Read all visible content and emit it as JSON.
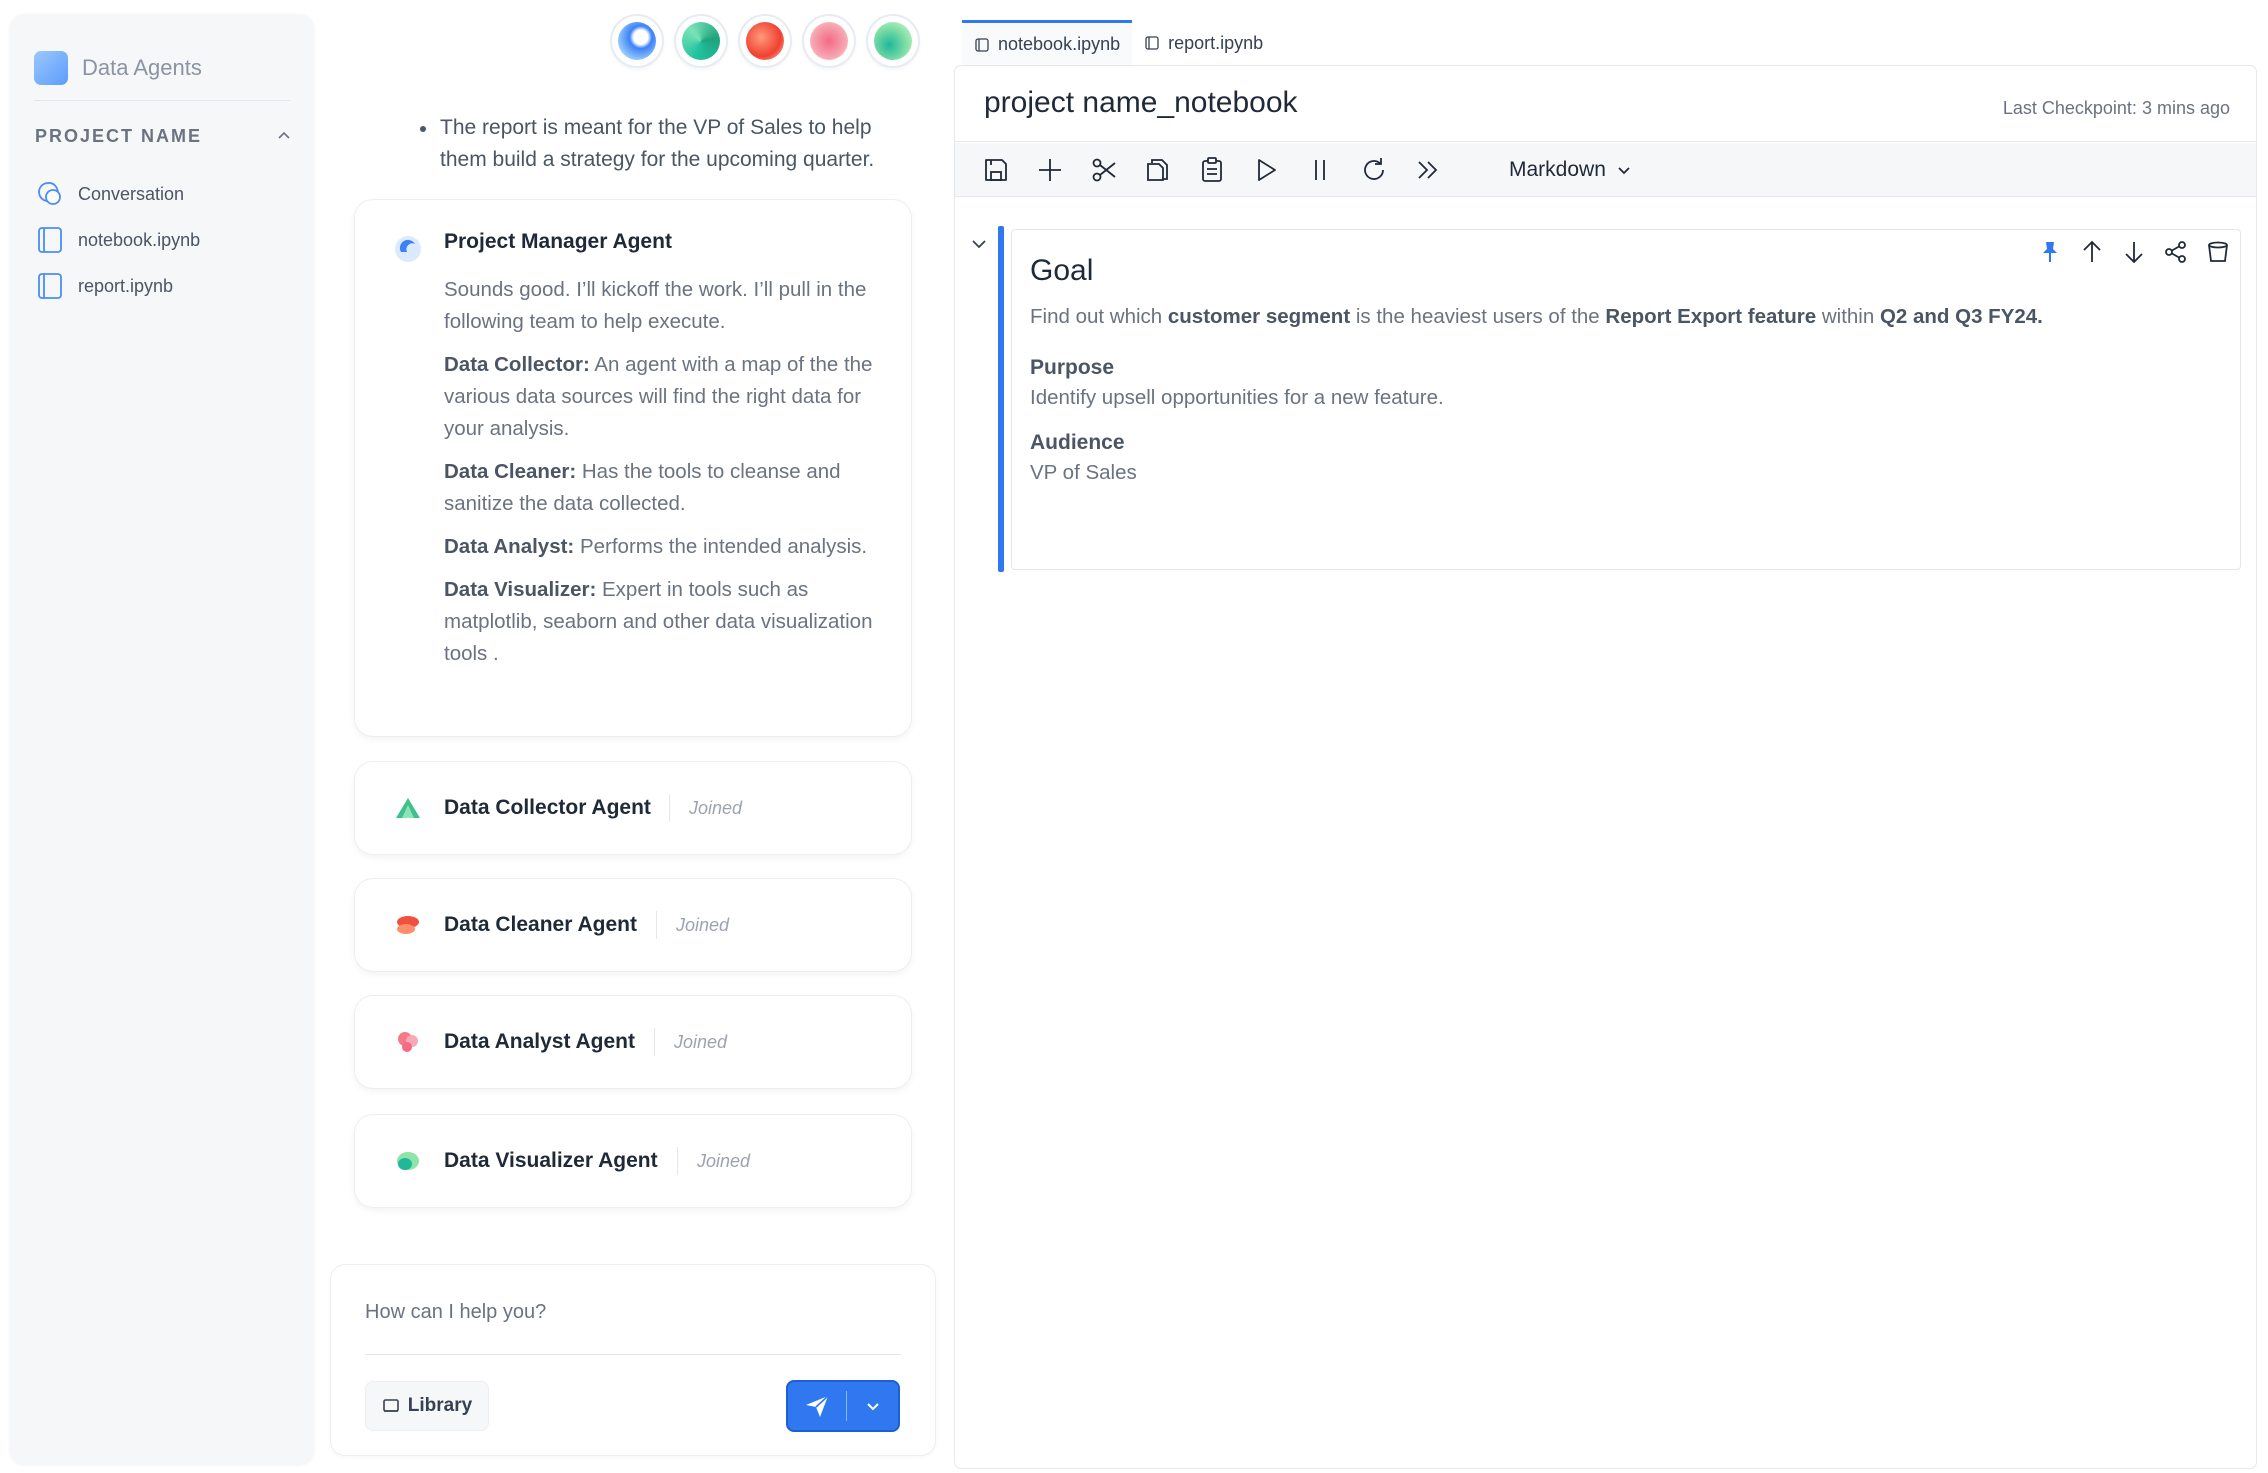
{
  "sidebar": {
    "brand": "Data Agents",
    "project_name": "PROJECT NAME",
    "items": [
      {
        "label": "Conversation",
        "icon": "chat-icon"
      },
      {
        "label": "notebook.ipynb",
        "icon": "notebook-file-icon"
      },
      {
        "label": "report.ipynb",
        "icon": "notebook-file-icon"
      }
    ]
  },
  "conversation": {
    "bullet": "The report is meant for the VP of Sales to help them build a strategy for the upcoming quarter.",
    "pm_card": {
      "title": "Project Manager Agent",
      "intro": "Sounds good. I’ll kickoff the work. I’ll pull in the following team to help execute.",
      "roles": [
        {
          "name": "Data Collector:",
          "desc": " An agent with a map of the the various data sources will find the right data for your analysis."
        },
        {
          "name": "Data Cleaner:",
          "desc": " Has the tools to cleanse and sanitize the data collected."
        },
        {
          "name": "Data Analyst:",
          "desc": " Performs the intended analysis."
        },
        {
          "name": "Data Visualizer:",
          "desc": " Expert in tools such as matplotlib, seaborn and other data visualization tools  ."
        }
      ]
    },
    "agents": [
      {
        "name": "Data Collector Agent",
        "status": "Joined",
        "color": "#3cc28a"
      },
      {
        "name": "Data Cleaner Agent",
        "status": "Joined",
        "color": "#f0503c"
      },
      {
        "name": "Data Analyst Agent",
        "status": "Joined",
        "color": "#f47a8a"
      },
      {
        "name": "Data Visualizer Agent",
        "status": "Joined",
        "color": "#34c49a"
      }
    ],
    "composer": {
      "placeholder": "How can I help you?",
      "library_label": "Library"
    }
  },
  "notebook": {
    "tabs": [
      {
        "label": "notebook.ipynb",
        "active": true
      },
      {
        "label": "report.ipynb",
        "active": false
      }
    ],
    "title": "project name_notebook",
    "checkpoint": "Last Checkpoint: 3 mins ago",
    "cell_type": "Markdown",
    "cell": {
      "heading": "Goal",
      "goal_parts": [
        "Find out which ",
        "customer segment",
        " is the heaviest users of the ",
        "Report Export feature",
        " within ",
        "Q2 and Q3 FY24."
      ],
      "purpose_label": "Purpose",
      "purpose_text": "Identify upsell opportunities for a new feature.",
      "audience_label": "Audience",
      "audience_text": "VP of Sales"
    }
  },
  "colors": {
    "accent": "#2f78f0",
    "sidebar_bg": "#f6f7f9"
  }
}
